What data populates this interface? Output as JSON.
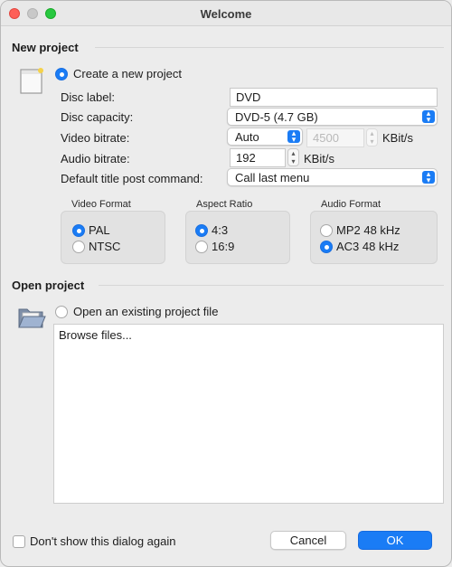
{
  "window": {
    "title": "Welcome"
  },
  "new_project": {
    "section_title": "New project",
    "create_radio_label": "Create a new project",
    "create_selected": true,
    "disc_label": {
      "label": "Disc label:",
      "value": "DVD"
    },
    "disc_capacity": {
      "label": "Disc capacity:",
      "value": "DVD-5 (4.7 GB)"
    },
    "video_bitrate": {
      "label": "Video bitrate:",
      "mode": "Auto",
      "value": "4500",
      "unit": "KBit/s"
    },
    "audio_bitrate": {
      "label": "Audio bitrate:",
      "value": "192",
      "unit": "KBit/s"
    },
    "post_command": {
      "label": "Default title post command:",
      "value": "Call last menu"
    },
    "video_format": {
      "title": "Video Format",
      "options": [
        "PAL",
        "NTSC"
      ],
      "selected": "PAL"
    },
    "aspect_ratio": {
      "title": "Aspect Ratio",
      "options": [
        "4:3",
        "16:9"
      ],
      "selected": "4:3"
    },
    "audio_format": {
      "title": "Audio Format",
      "options": [
        "MP2 48 kHz",
        "AC3 48 kHz"
      ],
      "selected": "AC3 48 kHz"
    }
  },
  "open_project": {
    "section_title": "Open project",
    "open_radio_label": "Open an existing project file",
    "open_selected": false,
    "file_list": [
      "Browse files..."
    ]
  },
  "footer": {
    "dont_show_label": "Don't show this dialog again",
    "dont_show_checked": false,
    "cancel_label": "Cancel",
    "ok_label": "OK"
  },
  "icons": {
    "new_project": "new-document-icon",
    "open_project": "open-folder-icon",
    "popup_arrows": "chevron-up-down-icon",
    "stepper": "stepper-up-down-icon"
  },
  "colors": {
    "accent": "#1a7cf5",
    "window_bg": "#ececec"
  }
}
